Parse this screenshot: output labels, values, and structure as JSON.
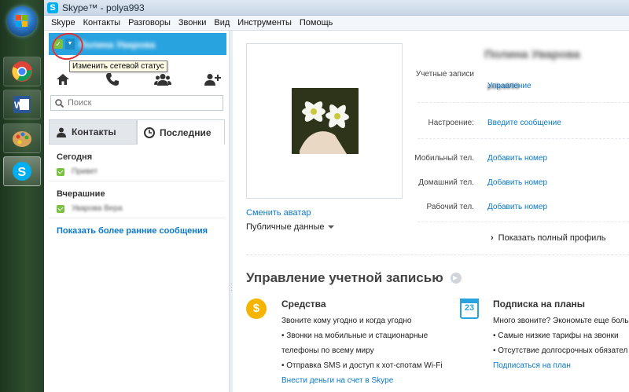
{
  "window": {
    "title": "Skype™ - polya993"
  },
  "menu": [
    "Skype",
    "Контакты",
    "Разговоры",
    "Звонки",
    "Вид",
    "Инструменты",
    "Помощь"
  ],
  "profile": {
    "name": "Полина Уварова",
    "status_tooltip": "Изменить сетевой статус"
  },
  "search": {
    "placeholder": "Поиск"
  },
  "tabs": {
    "contacts": "Контакты",
    "recent": "Последние"
  },
  "recent": {
    "today": "Сегодня",
    "today_items": [
      "Привет"
    ],
    "yesterday": "Вчерашние",
    "yesterday_items": [
      "Уварова Вера"
    ],
    "more": "Показать более ранние сообщения"
  },
  "details": {
    "name": "Полина Уварова",
    "account_label": "Учетные записи",
    "account_value": "polya993",
    "manage": "Управление",
    "mood_label": "Настроение:",
    "mood_value": "Введите сообщение",
    "mobile_label": "Мобильный тел.",
    "home_label": "Домашний тел.",
    "work_label": "Рабочий тел.",
    "add_number": "Добавить номер",
    "change_avatar": "Сменить аватар",
    "public_data": "Публичные данные",
    "full_profile": "Показать полный профиль"
  },
  "account": {
    "title": "Управление учетной записью",
    "funds": {
      "title": "Средства",
      "lines": [
        "Звоните кому угодно и когда угодно",
        "• Звонки на мобильные и стационарные",
        "телефоны по всему миру",
        "• Отправка SMS и доступ к хот-спотам Wi-Fi"
      ],
      "link": "Внести деньги на счет в Skype"
    },
    "plans": {
      "title": "Подписка на планы",
      "icon_text": "23",
      "lines": [
        "Много звоните? Экономьте еще боль",
        "• Самые низкие тарифы на звонки",
        "• Отсутствие долгосрочных обязател"
      ],
      "link": "Подписаться на план"
    }
  },
  "colors": {
    "accent": "#29a3e0",
    "link": "#0a78c8",
    "online": "#7ac142"
  }
}
